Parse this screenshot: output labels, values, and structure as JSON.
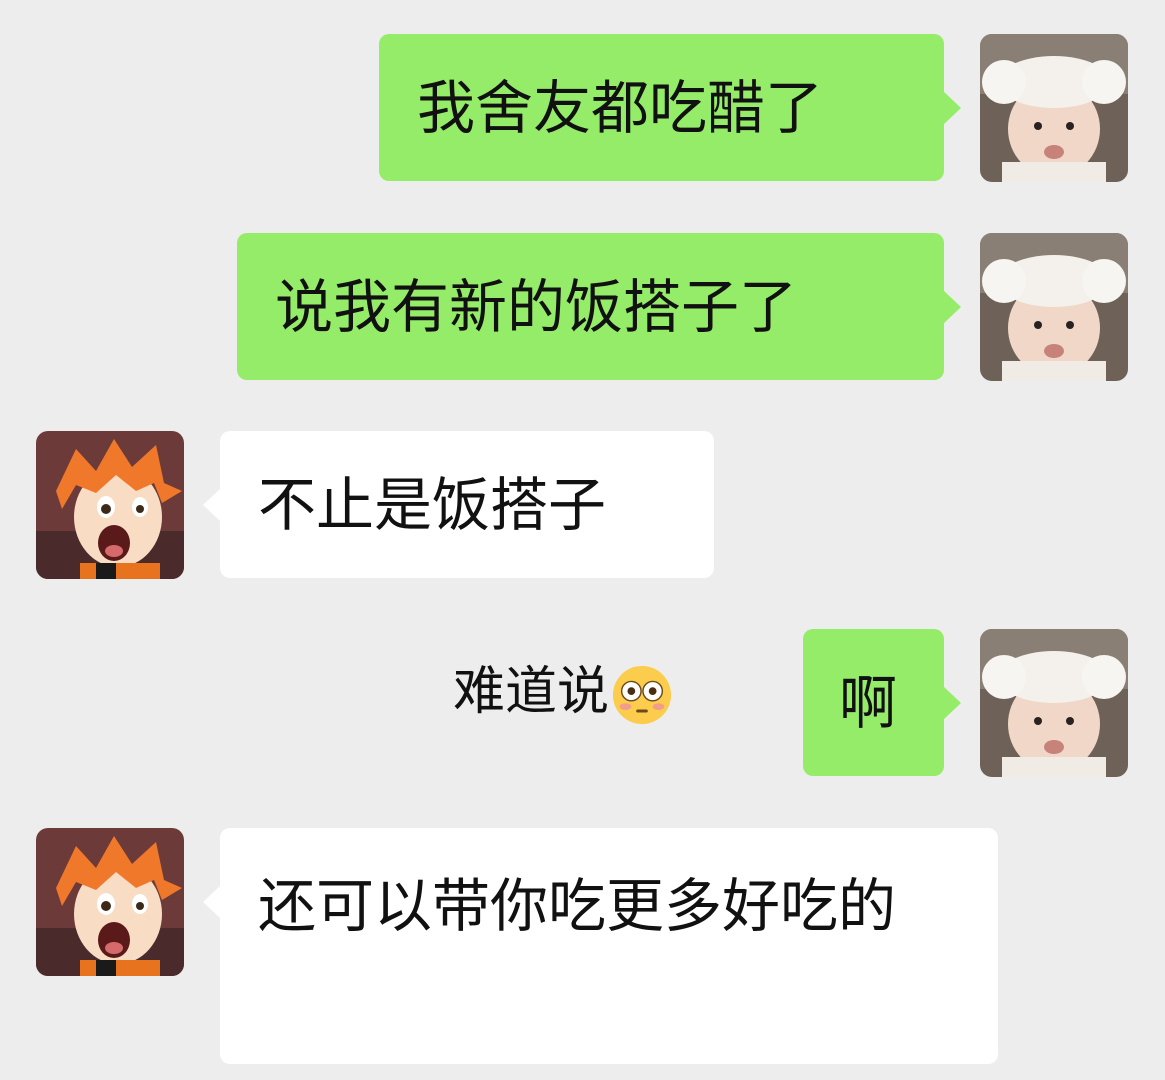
{
  "chat": {
    "messages": [
      {
        "side": "out",
        "text": "我舍友都吃醋了"
      },
      {
        "side": "out",
        "text": "说我有新的饭搭子了"
      },
      {
        "side": "in",
        "text": "不止是饭搭子"
      },
      {
        "side": "out",
        "text": "啊",
        "plain_text": "难道说"
      },
      {
        "side": "in",
        "text": "还可以带你吃更多好吃的"
      }
    ]
  },
  "icons": {
    "self_avatar": "toddler-photo-avatar",
    "other_avatar": "anime-boy-avatar",
    "emoji": "flushed-face-emoji"
  },
  "colors": {
    "background": "#ededed",
    "outgoing_bubble": "#95ec69",
    "incoming_bubble": "#ffffff"
  }
}
